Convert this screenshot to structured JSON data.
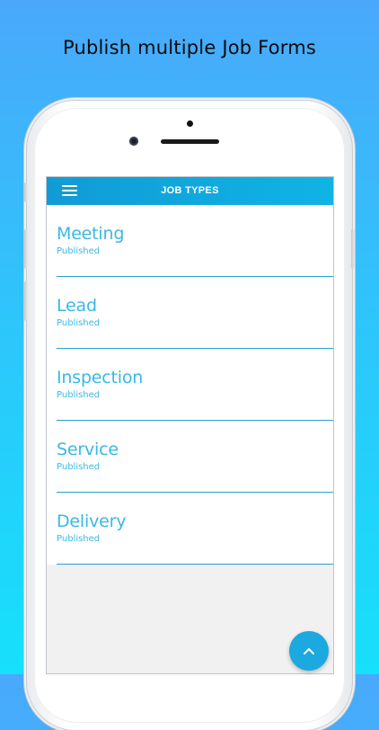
{
  "headline": "Publish multiple Job Forms",
  "appbar": {
    "title": "JOB TYPES",
    "menu_icon": "hamburger-menu-icon",
    "color": "#119bd6"
  },
  "job_types": [
    {
      "title": "Meeting",
      "status": "Published"
    },
    {
      "title": "Lead",
      "status": "Published"
    },
    {
      "title": "Inspection",
      "status": "Published"
    },
    {
      "title": "Service",
      "status": "Published"
    },
    {
      "title": "Delivery",
      "status": "Published"
    }
  ],
  "fab": {
    "icon": "chevron-up-icon"
  },
  "colors": {
    "accent": "#39b8e6",
    "divider": "#2a9fcf",
    "background_top": "#4aa8fb",
    "background_bottom": "#16e0fb"
  }
}
